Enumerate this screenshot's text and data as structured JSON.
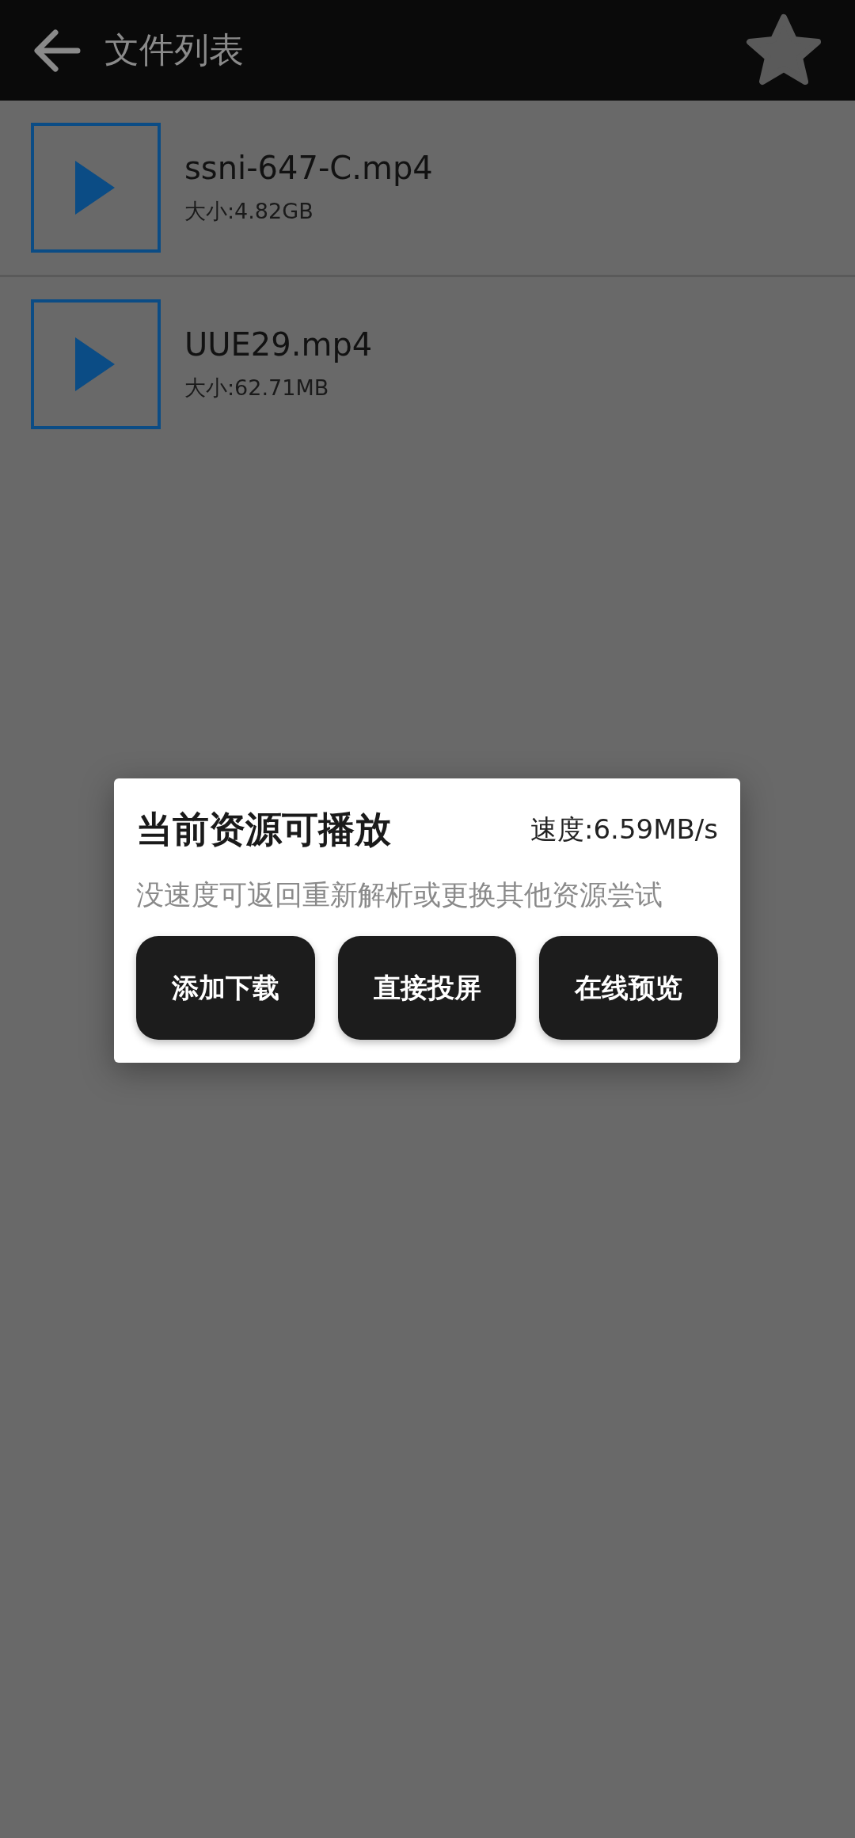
{
  "app_bar": {
    "title": "文件列表"
  },
  "files": [
    {
      "name": "ssni-647-C.mp4",
      "size": "大小:4.82GB"
    },
    {
      "name": "UUE29.mp4",
      "size": "大小:62.71MB"
    }
  ],
  "dialog": {
    "title": "当前资源可播放",
    "speed": "速度:6.59MB/s",
    "message": "没速度可返回重新解析或更换其他资源尝试",
    "buttons": [
      "添加下载",
      "直接投屏",
      "在线预览"
    ]
  }
}
